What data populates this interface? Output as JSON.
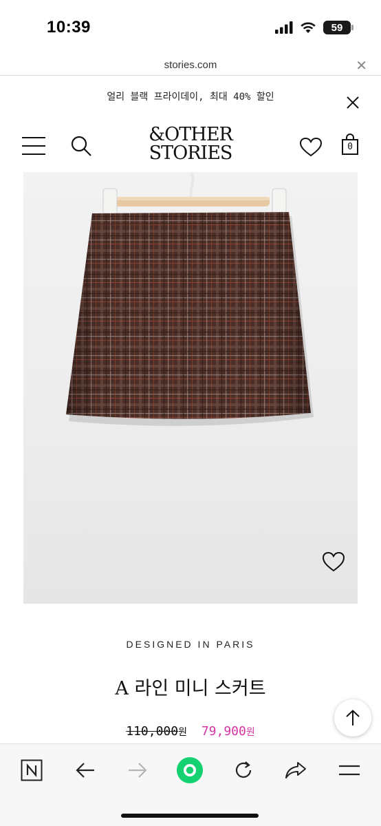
{
  "status": {
    "time": "10:39",
    "battery": "59"
  },
  "browser": {
    "url": "stories.com"
  },
  "promo": {
    "text": "얼리 블랙 프라이데이, 최대 40% 할인"
  },
  "header": {
    "logo_line1": "&OTHER",
    "logo_line2": "STORIES",
    "cart_count": "0"
  },
  "product": {
    "designed_in": "DESIGNED IN PARIS",
    "title": "A 라인 미니 스커트",
    "original_price": "110,000",
    "sale_price": "79,900",
    "currency_suffix": "원"
  },
  "colors": {
    "sale_price": "#d633a2",
    "nav_button_green": "#14d171",
    "skirt_brown": "#4b2e28"
  },
  "toolbar": {
    "icons": [
      "naver-n-icon",
      "back-arrow-icon",
      "forward-arrow-icon",
      "green-circle-icon",
      "reload-icon",
      "share-icon",
      "menu-icon"
    ]
  }
}
